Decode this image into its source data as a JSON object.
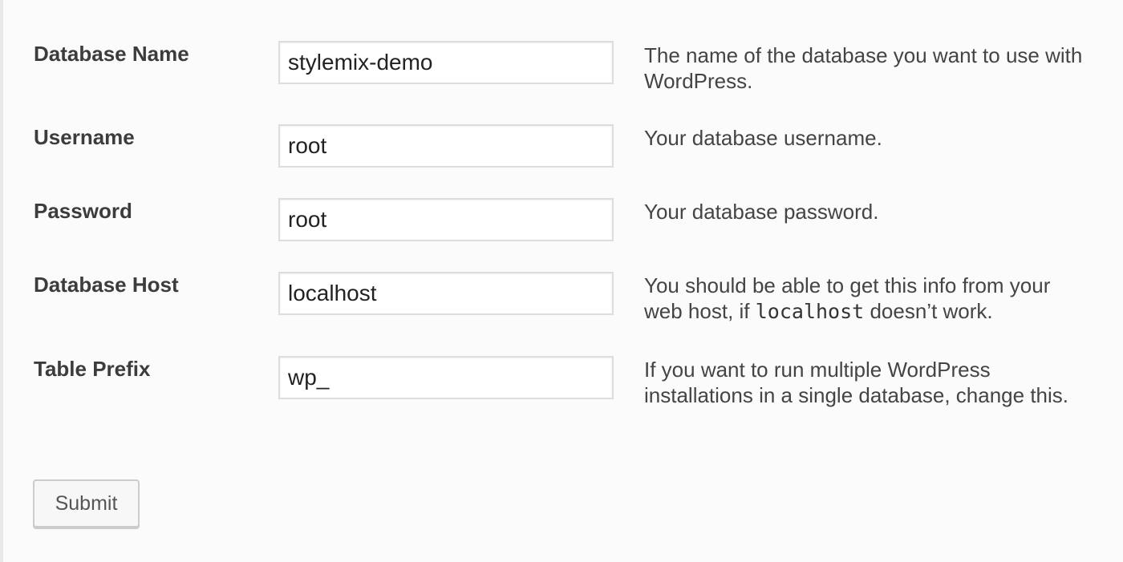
{
  "form": {
    "fields": [
      {
        "label": "Database Name",
        "value": "stylemix-demo",
        "description": "The name of the database you want to use with WordPress."
      },
      {
        "label": "Username",
        "value": "root",
        "description": "Your database username."
      },
      {
        "label": "Password",
        "value": "root",
        "description": "Your database password."
      },
      {
        "label": "Database Host",
        "value": "localhost",
        "description_before": "You should be able to get this info from your web host, if",
        "description_code": "localhost",
        "description_after": "doesn’t work."
      },
      {
        "label": "Table Prefix",
        "value": "wp_",
        "description": "If you want to run multiple WordPress installations in a single database, change this."
      }
    ],
    "submit_label": "Submit"
  }
}
